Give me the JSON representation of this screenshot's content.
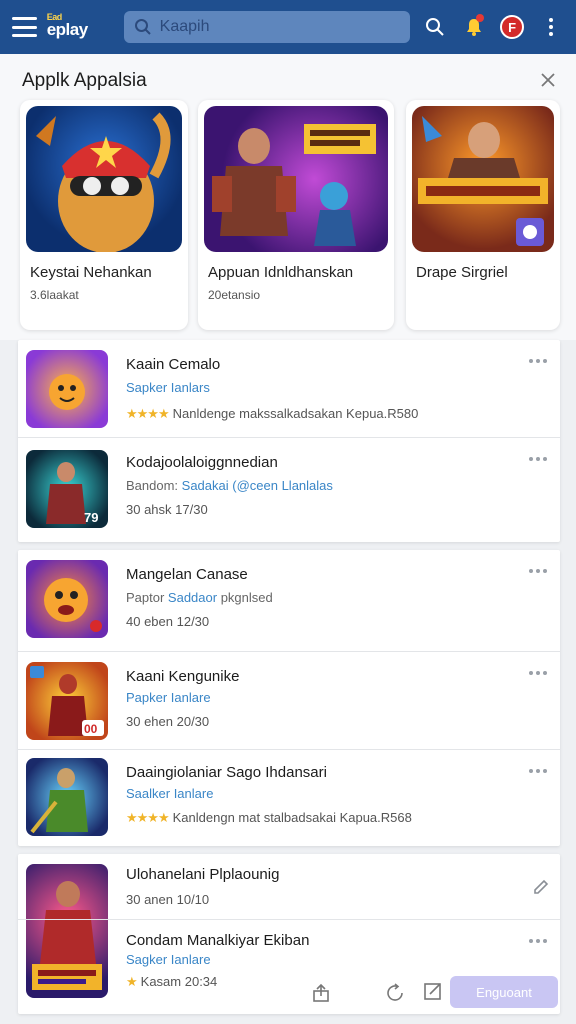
{
  "header": {
    "logo_top": "Ead",
    "logo_main": "eplay",
    "search_placeholder": "Kaapih"
  },
  "featured": {
    "title": "Applk Appalsia",
    "cards": [
      {
        "title": "Keystai Nehankan",
        "meta": "3.6laakat"
      },
      {
        "title": "Appuan Idnldhanskan",
        "meta": "20etansio"
      },
      {
        "title": "Drape Sirgriel",
        "meta": ""
      }
    ]
  },
  "list_groups": [
    {
      "rows": [
        {
          "title": "Kaain Cemalo",
          "sub_prefix": "",
          "sub_highlight": "Sapker Ianlars",
          "desc": "Nanldenge makssalkadsakan Kepua.R580",
          "rating": "★★★★"
        },
        {
          "title": "Kodajoolaloiggnnedian",
          "sub_prefix": "Bandom: ",
          "sub_highlight": "Sadakai (@ceen Llanlalas",
          "desc": "30 ahsk 17/30",
          "rating": ""
        }
      ]
    },
    {
      "rows": [
        {
          "title": "Mangelan Canase",
          "sub_prefix": "Paptor ",
          "sub_highlight": "Saddaor ",
          "sub_suffix": "pkgnlsed",
          "desc": "40 eben 12/30",
          "rating": ""
        },
        {
          "title": "Kaani Kengunike",
          "sub_prefix": "",
          "sub_highlight": "Papker Ianlare",
          "desc": "30 ehen 20/30",
          "rating": "",
          "badge": "00"
        },
        {
          "title": "Daaingiolaniar Sago Ihdansari",
          "sub_prefix": "",
          "sub_highlight": "Saalker Ianlare",
          "desc": "Kanldengn mat stalbadsakai Kapua.R568",
          "rating": "★★★★"
        }
      ]
    },
    {
      "rows": [
        {
          "title": "Ulohanelani Plplaounig",
          "desc": "30 anen 10/10"
        },
        {
          "title": "Condam Manalkiyar Ekiban",
          "sub_highlight": "Sagker Ianlare",
          "desc": "Kasam 20:34",
          "rating": "★"
        }
      ]
    }
  ],
  "bottom_bar": {
    "primary_label": "Enguoant"
  },
  "colors": {
    "topbar": "#1f4f8f",
    "accent": "#3a86c7",
    "star": "#f0b429",
    "avatar": "#d32a2a"
  },
  "icons": [
    "menu-icon",
    "search-icon",
    "bell-icon",
    "avatar-icon",
    "more-vertical-icon",
    "close-icon",
    "more-horizontal-icon",
    "edit-icon",
    "share-icon",
    "refresh-icon",
    "export-icon"
  ]
}
